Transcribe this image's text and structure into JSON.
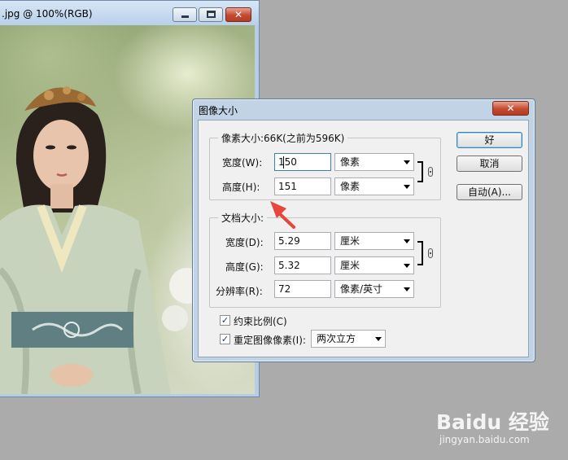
{
  "document_window": {
    "title": ".jpg @ 100%(RGB)",
    "close_glyph": "✕"
  },
  "dialog": {
    "title": "图像大小",
    "close_glyph": "✕",
    "pixel_group": {
      "title": "像素大小:66K(之前为596K)",
      "width_label": "宽度(W):",
      "width_value": "150",
      "width_unit": "像素",
      "height_label": "高度(H):",
      "height_value": "151",
      "height_unit": "像素"
    },
    "document_group": {
      "title": "文档大小:",
      "width_label": "宽度(D):",
      "width_value": "5.29",
      "width_unit": "厘米",
      "height_label": "高度(G):",
      "height_value": "5.32",
      "height_unit": "厘米",
      "resolution_label": "分辨率(R):",
      "resolution_value": "72",
      "resolution_unit": "像素/英寸"
    },
    "buttons": {
      "ok": "好",
      "cancel": "取消",
      "auto": "自动(A)..."
    },
    "constrain_proportions": {
      "label": "约束比例(C)",
      "checked": true,
      "mark": "✓"
    },
    "resample": {
      "label": "重定图像像素(I):",
      "checked": true,
      "mark": "✓",
      "method": "两次立方"
    }
  },
  "watermark": {
    "main": "Baidu 经验",
    "sub": "jingyan.baidu.com"
  },
  "colors": {
    "annotation_arrow": "#e8453c",
    "dialog_frame": "#c3d3e6"
  }
}
